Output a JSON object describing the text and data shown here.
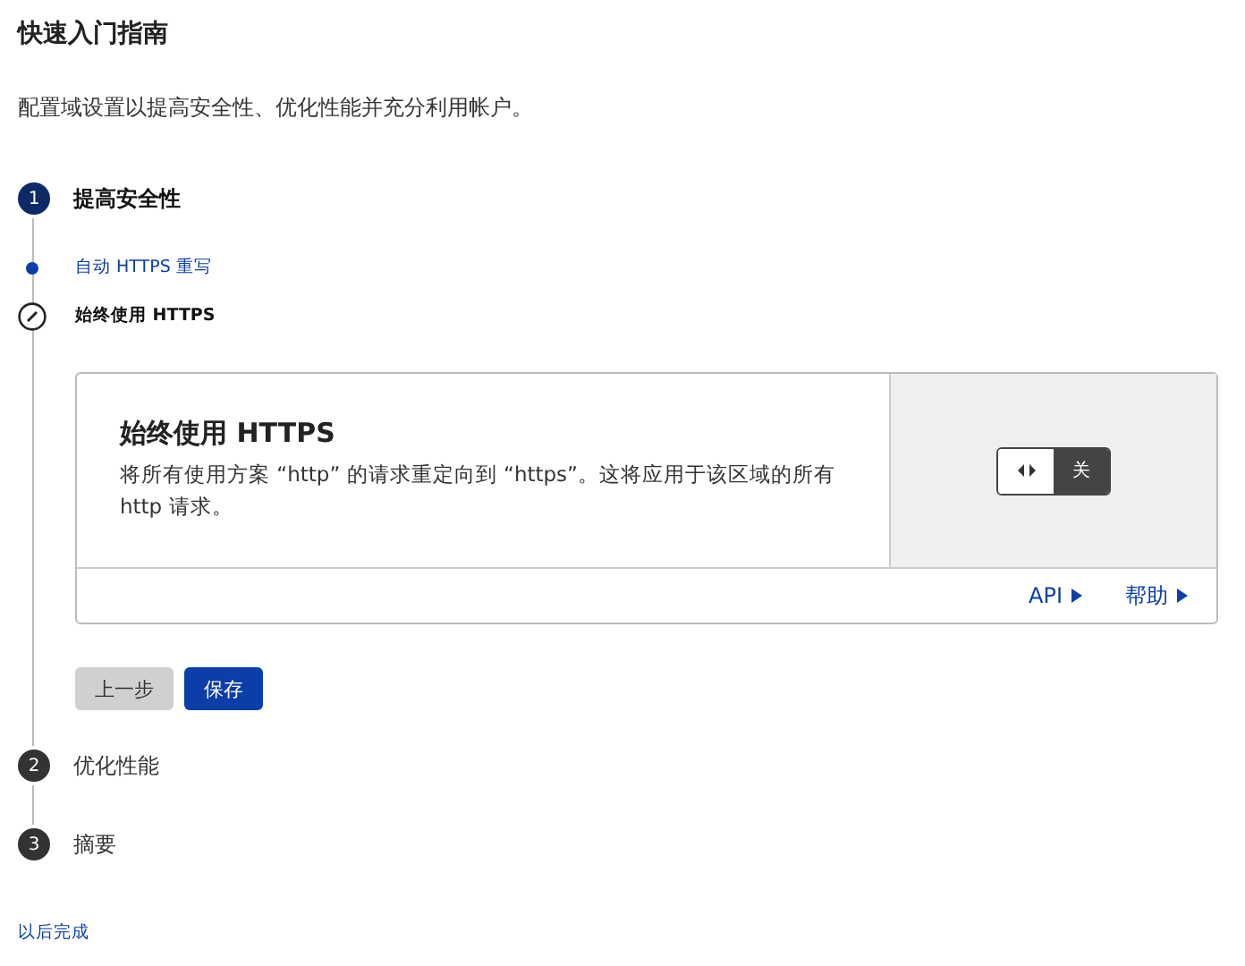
{
  "title": "快速入门指南",
  "subtitle": "配置域设置以提高安全性、优化性能并充分利用帐户。",
  "steps": [
    {
      "number": "1",
      "label": "提高安全性",
      "active": true,
      "substeps": [
        {
          "label": "自动 HTTPS 重写",
          "selected": false
        },
        {
          "label": "始终使用 HTTPS",
          "selected": true
        }
      ],
      "card": {
        "title": "始终使用 HTTPS",
        "description": "将所有使用方案 “http” 的请求重定向到 “https”。这将应用于该区域的所有 http 请求。",
        "toggle": {
          "label": "关",
          "on": false
        },
        "links": [
          "API",
          "帮助"
        ]
      },
      "buttons": [
        {
          "label": "上一步",
          "kind": "secondary"
        },
        {
          "label": "保存",
          "kind": "primary"
        }
      ]
    },
    {
      "number": "2",
      "label": "优化性能",
      "active": false
    },
    {
      "number": "3",
      "label": "摘要",
      "active": false
    }
  ],
  "finish_link": "以后完成"
}
